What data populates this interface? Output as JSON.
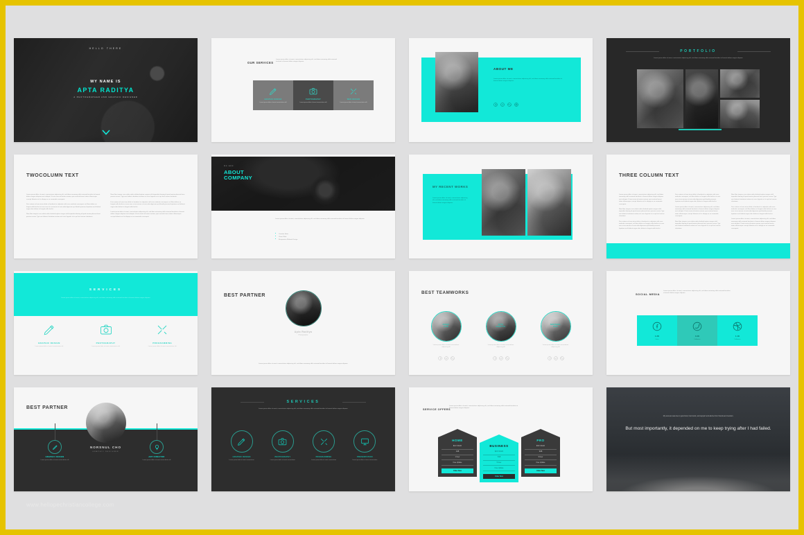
{
  "meta": {
    "watermark": "www.hellopechristiancollege.com",
    "accent_cyan": "#12e8d8",
    "accent_teal": "#1ec9b6",
    "dark": "#2d2d2d",
    "frame_color": "#e6c300",
    "page_bg": "#dfdfe0"
  },
  "lorem": {
    "p1": "Lorem ipsum dolor sit amet, consectetuer adipiscing elit, sed diam nonummy nibh euismod tincidunt ut laoreet dolore magna aliquam erat volutpat. Ut wisi enim ad minim veniam, quis nostrud exerci tation ullamcorper suscipit lobortis nisl ut aliquip ex ea commodo consequat.",
    "p2": "Duis autem vel eum iriure dolor in hendrerit in vulputate velit esse molestie consequat, vel illum dolore eu feugiat nulla facilisis at vero eros et accumsan et iusto odio dignissim qui blandit praesent luptatum zzril delenit augue duis dolore te feugait nulla facilisi.",
    "p3": "Nam liber tempor cum soluta nobis eleifend option congue nihil imperdiet doming id quod mazim placerat facer possim assum. Typi non habent claritatem insitam est usus legentis in iis qui facit eorum claritatem.",
    "short": "Lorem ipsum dolor sit amet, consectetuer adipiscing elit, sed diam nonummy nibh euismod tincidunt ut laoreet dolore magna aliquam."
  },
  "slides": [
    {
      "id": "hello-there",
      "eyebrow": "HELLO THERE",
      "pre_title": "MY NAME IS",
      "title": "APTA RADITYA",
      "subtitle_line1": "A PHOTOGRAPHER AND",
      "subtitle_line2": "GRAPHIC DESIGNER",
      "scroll_icon": "chevron-down-icon"
    },
    {
      "id": "our-services",
      "title_line1": "OUR",
      "title_line2": "SERVICES",
      "cards": [
        {
          "icon": "pencil-ruler-icon",
          "label": "GRAPHIC DESIGN",
          "desc": "Lorem ipsum dolor sit amet consectetuer elit"
        },
        {
          "icon": "camera-icon",
          "label": "PHOTOGRAPHY",
          "desc": "Lorem ipsum dolor sit amet consectetuer elit"
        },
        {
          "icon": "tools-icon",
          "label": "WEB DESIGN",
          "desc": "Lorem ipsum dolor sit amet consectetuer elit"
        }
      ]
    },
    {
      "id": "about-me",
      "title_line1": "ABOUT",
      "title_line2": "ME",
      "photo": "portrait-man-sunglasses",
      "social": [
        "facebook-icon",
        "twitter-icon",
        "dribbble-icon",
        "instagram-icon"
      ]
    },
    {
      "id": "portfolio",
      "title": "PORTFOLIO",
      "images": [
        "portfolio-image-1",
        "portfolio-image-2",
        "portfolio-image-3",
        "portfolio-image-4"
      ]
    },
    {
      "id": "twocolumn-text",
      "title_line1": "TWOCOLUMN",
      "title_line2": "TEXT"
    },
    {
      "id": "about-company",
      "eyebrow": "WE ARE",
      "title_line1": "ABOUT",
      "title_line2": "COMPANY",
      "bullets": [
        "Creative Ideas",
        "Clean Work",
        "Responsive Website Design"
      ]
    },
    {
      "id": "my-recent-works",
      "title_line1": "MY RECENT",
      "title_line2": "WORKS",
      "images": [
        "recent-work-1",
        "recent-work-2"
      ]
    },
    {
      "id": "threecolumn-text",
      "title_line1": "THREE COLUMN",
      "title_line2": "TEXT"
    },
    {
      "id": "services-light",
      "title": "SERVICES",
      "items": [
        {
          "icon": "pencil-ruler-icon",
          "label": "GRAPHIC DESIGN",
          "desc": "Lorem ipsum dolor sit amet consectetuer elit"
        },
        {
          "icon": "camera-icon",
          "label": "PHOTOGRAPHY",
          "desc": "Lorem ipsum dolor sit amet consectetuer elit"
        },
        {
          "icon": "tools-icon",
          "label": "PROGRAMMING",
          "desc": "Lorem ipsum dolor sit amet consectetuer elit"
        }
      ]
    },
    {
      "id": "best-partner-light",
      "title_line1": "BEST",
      "title_line2": "PARTNER",
      "name": "Apta Raditya",
      "role": "Photographer",
      "photo": "portrait-dark-woman"
    },
    {
      "id": "best-teamworks",
      "title_line1": "BEST",
      "title_line2": "TEAMWORKS",
      "members": [
        {
          "name_line1": "ANGGI",
          "name_line2": "AJIE",
          "desc": "Lorem ipsum dolor sit amet consectetuer adipiscing elit",
          "social": [
            "facebook-icon",
            "twitter-icon",
            "dribbble-icon"
          ]
        },
        {
          "name_line1": "APTA",
          "name_line2": "RADITYA",
          "desc": "Lorem ipsum dolor sit amet consectetuer adipiscing elit",
          "social": [
            "facebook-icon",
            "twitter-icon",
            "dribbble-icon"
          ]
        },
        {
          "name_line1": "NORSNUL",
          "name_line2": "CHO",
          "desc": "Lorem ipsum dolor sit amet consectetuer adipiscing elit",
          "social": [
            "facebook-icon",
            "twitter-icon",
            "dribbble-icon"
          ]
        }
      ]
    },
    {
      "id": "social-media",
      "title_line1": "SOCIAL",
      "title_line2": "MEDIA",
      "cards": [
        {
          "icon": "facebook-icon",
          "count": "1.2K",
          "network": "Likes"
        },
        {
          "icon": "twitter-icon",
          "count": "3.4K",
          "network": "Followers"
        },
        {
          "icon": "dribbble-icon",
          "count": "1.1K",
          "network": "Followers"
        }
      ]
    },
    {
      "id": "best-partner-dark",
      "title_line1": "BEST",
      "title_line2": "PARTNER",
      "name": "NORSNUL CHO",
      "role": "GRAPHIC DESIGNER",
      "left": {
        "icon": "pencil-icon",
        "label": "GRAPHIC DESIGN",
        "desc": "Lorem ipsum dolor sit amet consectetuer elit"
      },
      "right": {
        "icon": "bulb-icon",
        "label": "ART DIRECTOR",
        "desc": "Lorem ipsum dolor sit amet consectetuer elit"
      }
    },
    {
      "id": "services-dark",
      "title": "SERVICES",
      "items": [
        {
          "icon": "pencil-ruler-icon",
          "label": "GRAPHIC DESIGN",
          "desc": "Lorem ipsum dolor sit amet consectetuer"
        },
        {
          "icon": "camera-icon",
          "label": "PHOTOGRAPHY",
          "desc": "Lorem ipsum dolor sit amet consectetuer"
        },
        {
          "icon": "tools-icon",
          "label": "PROGRAMMING",
          "desc": "Lorem ipsum dolor sit amet consectetuer"
        },
        {
          "icon": "presentation-icon",
          "label": "PRESENTATION",
          "desc": "Lorem ipsum dolor sit amet consectetuer"
        }
      ]
    },
    {
      "id": "service-offers",
      "title_line1": "SERVICE",
      "title_line2": "OFFERS",
      "plans": [
        {
          "name": "HOME",
          "price": "$12 / Month",
          "storage": "1GB",
          "users": "1 User",
          "updates": "Free Update",
          "button": "Order Now"
        },
        {
          "name": "BUSINESS",
          "price": "$24 / Month",
          "storage": "5GB",
          "users": "5 User",
          "updates": "Free Update",
          "button": "Order Now"
        },
        {
          "name": "PRO",
          "price": "$32 / Month",
          "storage": "9GB",
          "users": "9 User",
          "updates": "Free Update",
          "button": "Order Now"
        }
      ]
    },
    {
      "id": "quote",
      "small": "My success was due to good luck, hard work, and support and advice from friends and mentors.",
      "quote": "But most importantly, it depended on me to keep trying after I had failed."
    }
  ]
}
